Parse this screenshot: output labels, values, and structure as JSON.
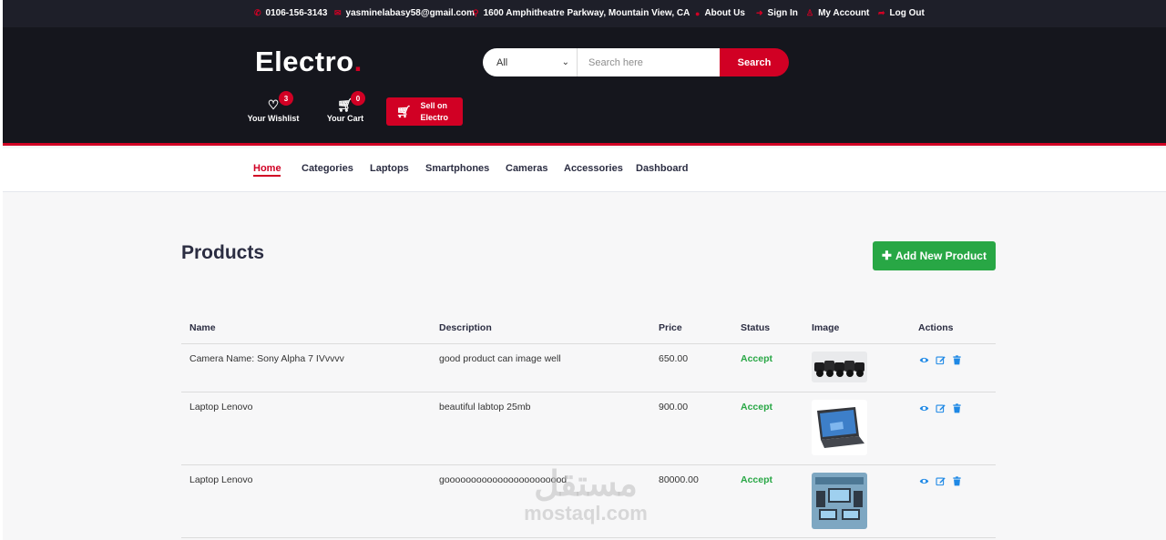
{
  "topbar": {
    "phone": "0106-156-3143",
    "email": "yasminelabasy58@gmail.com",
    "address": "1600 Amphitheatre Parkway, Mountain View, CA",
    "links": [
      "About Us",
      "Sign In",
      "My Account",
      "Log Out"
    ]
  },
  "header": {
    "logo_text": "Electro",
    "logo_dot": ".",
    "search": {
      "category": "All",
      "placeholder": "Search here",
      "button": "Search"
    },
    "wishlist": {
      "label": "Your Wishlist",
      "count": "3"
    },
    "cart": {
      "label": "Your Cart",
      "count": "0"
    },
    "sell": {
      "line1": "Sell on",
      "line2": "Electro"
    }
  },
  "nav": {
    "items": [
      "Home",
      "Categories",
      "Laptops",
      "Smartphones",
      "Cameras",
      "Accessories",
      "Dashboard"
    ],
    "active": "Home"
  },
  "main": {
    "title": "Products",
    "add_button": "Add New Product",
    "table": {
      "headers": [
        "Name",
        "Description",
        "Price",
        "Status",
        "Image",
        "Actions"
      ],
      "rows": [
        {
          "name": "Camera Name: Sony Alpha 7 IVvvvv",
          "description": "good product can image well",
          "price": "650.00",
          "status": "Accept",
          "image": "cameras-photo"
        },
        {
          "name": "Laptop Lenovo",
          "description": "beautiful labtop 25mb",
          "price": "900.00",
          "status": "Accept",
          "image": "laptop-photo"
        },
        {
          "name": "Laptop Lenovo",
          "description": "gooooooooooooooooooooood",
          "price": "80000.00",
          "status": "Accept",
          "image": "devices-photo"
        }
      ]
    }
  },
  "watermark": {
    "arabic": "مستقل",
    "latin": "mostaql.com"
  },
  "colors": {
    "brand_red": "#d10024",
    "dark_bg": "#15161d",
    "topbar_bg": "#1e1f29",
    "success_green": "#28a745",
    "action_blue": "#1e88e5"
  }
}
